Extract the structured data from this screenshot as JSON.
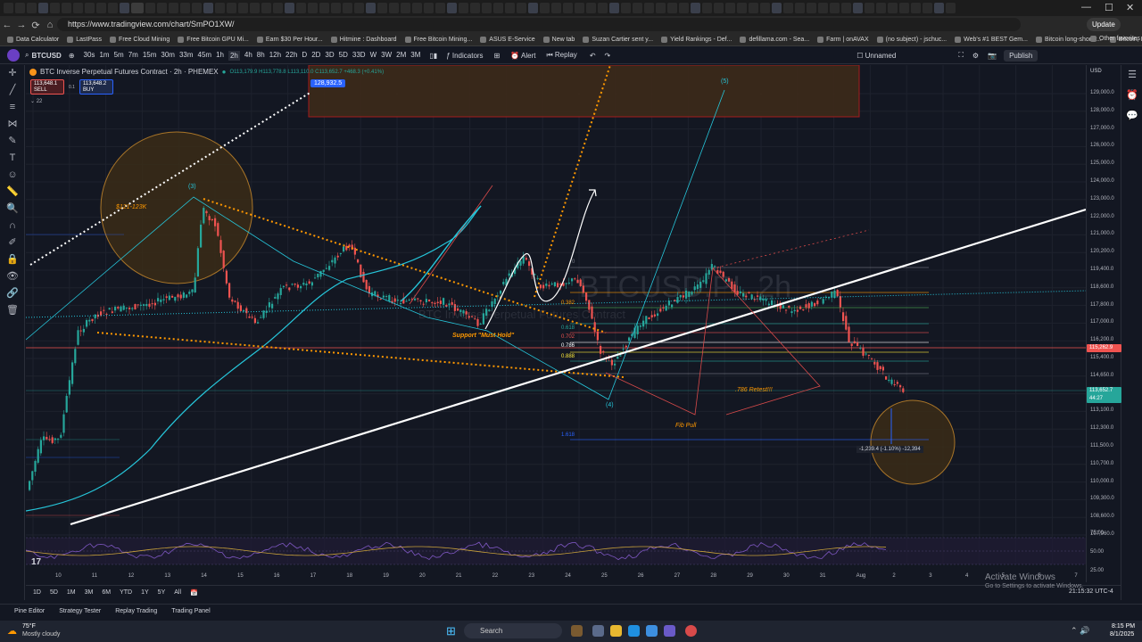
{
  "browser": {
    "url": "https://www.tradingview.com/chart/SmPO1XW/",
    "update_label": "Update",
    "bookmarks": [
      "Data Calculator",
      "LastPass",
      "Free Cloud Mining",
      "Free Bitcoin GPU Mi...",
      "Earn $30 Per Hour...",
      "Hitmine : Dashboard",
      "Free Bitcoin Mining...",
      "ASUS E-Service",
      "New tab",
      "Suzan Cartier sent y...",
      "Yield Rankings - Def...",
      "defillama.com - Sea...",
      "Farm | onAVAX",
      "(no subject) - jschuc...",
      "Web's #1 BEST Gem...",
      "Bitcoin long-short r...",
      "Bitcoin, Ethereum, a..."
    ],
    "other_favorites": "Other favorites"
  },
  "toolbar": {
    "symbol": "BTCUSD",
    "timeframes": [
      "30s",
      "1m",
      "5m",
      "7m",
      "15m",
      "30m",
      "33m",
      "45m",
      "1h",
      "2h",
      "4h",
      "8h",
      "12h",
      "22h",
      "D",
      "2D",
      "3D",
      "5D",
      "33D",
      "W",
      "3W",
      "2M",
      "3M"
    ],
    "indicators_label": "Indicators",
    "alert_label": "Alert",
    "replay_label": "Replay",
    "layout_name": "Unnamed",
    "publish_label": "Publish"
  },
  "legend": {
    "title": "BTC Inverse Perpetual Futures Contract · 2h · PHEMEX",
    "ohlc": "O113,179.9 H113,778.8 L113,110.0 C113,652.7 +468.3 (+0.41%)",
    "sell_price": "113,648.1",
    "sell_label": "SELL",
    "buy_price": "113,648.2",
    "buy_label": "BUY",
    "spread": "0.1",
    "indicator_count": "22"
  },
  "watermark": {
    "big": "BTCUSD.PI, 2h",
    "small": "BTC Inverse Perpetual Futures Contract"
  },
  "annotations": {
    "target_price": "128,932.5",
    "wave5": "(5)",
    "wave3": "(3)",
    "wave4": "(4)",
    "range_note": "$121-123K",
    "support_note": "Support \"Must Hold\"",
    "retest_note": ".786 Retest!!!",
    "fib_pull_note": "Fib Pull",
    "measure_note": "-1,239.4 (-1.10%) -12,394",
    "fib_0": "0",
    "fib_0382": "0.382",
    "fib_0618": "0.618",
    "fib_0702": "0.702",
    "fib_0786": "0.786",
    "fib_0888": "0.888",
    "fib_1618": "1.618"
  },
  "price_axis": {
    "currency": "USD",
    "labels": [
      "129,000.0",
      "128,000.0",
      "127,000.0",
      "126,000.0",
      "125,000.0",
      "124,000.0",
      "123,000.0",
      "122,000.0",
      "121,000.0",
      "120,200.0",
      "119,400.0",
      "118,600.0",
      "117,800.0",
      "117,000.0",
      "116,200.0",
      "115,400.0",
      "114,650.0",
      "113,900.0",
      "113,100.0",
      "112,300.0",
      "111,500.0",
      "110,700.0",
      "110,000.0",
      "109,300.0",
      "108,600.0",
      "107,960.0"
    ],
    "current_price": "113,652.7",
    "countdown": "44:27",
    "red_tag": "115,262.9",
    "osc_labels": [
      "75.00",
      "50.00",
      "25.00"
    ]
  },
  "date_axis": [
    "10",
    "11",
    "12",
    "13",
    "14",
    "15",
    "16",
    "17",
    "18",
    "19",
    "20",
    "21",
    "22",
    "23",
    "24",
    "25",
    "26",
    "27",
    "28",
    "29",
    "30",
    "31",
    "Aug",
    "2",
    "3",
    "4",
    "5",
    "6",
    "7"
  ],
  "range_bar": {
    "ranges": [
      "1D",
      "5D",
      "1M",
      "3M",
      "6M",
      "YTD",
      "1Y",
      "5Y",
      "All"
    ],
    "clock": "21:15:32 UTC-4"
  },
  "bottom_panel": [
    "Pine Editor",
    "Strategy Tester",
    "Replay Trading",
    "Trading Panel"
  ],
  "windows_overlay": {
    "title": "Activate Windows",
    "subtitle": "Go to Settings to activate Windows."
  },
  "taskbar": {
    "weather_temp": "75°F",
    "weather_desc": "Mostly cloudy",
    "search_label": "Search",
    "time": "8:15 PM",
    "date": "8/1/2025"
  },
  "colors": {
    "bg": "#131722",
    "up": "#26a69a",
    "down": "#ef5350",
    "accent": "#2962ff",
    "orange": "#ff9800",
    "teal": "#26c6da"
  }
}
